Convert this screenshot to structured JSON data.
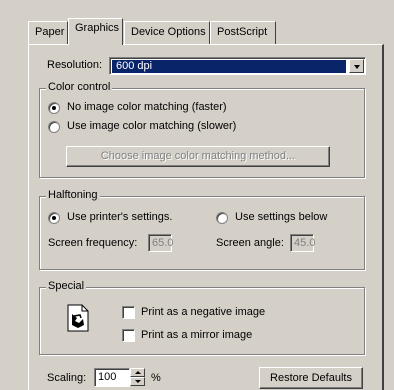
{
  "tabs": [
    "Paper",
    "Graphics",
    "Device Options",
    "PostScript"
  ],
  "active_tab": "Graphics",
  "resolution": {
    "label": "Resolution:",
    "value": "600 dpi"
  },
  "color_control": {
    "title": "Color control",
    "option_none": "No image color matching (faster)",
    "option_use": "Use image color matching (slower)",
    "choose_button": "Choose image color matching method..."
  },
  "halftoning": {
    "title": "Halftoning",
    "option_printer": "Use printer's settings.",
    "option_below": "Use settings below",
    "frequency_label": "Screen frequency:",
    "frequency_value": "65.0",
    "angle_label": "Screen angle:",
    "angle_value": "45.0"
  },
  "special": {
    "title": "Special",
    "negative": "Print as a negative image",
    "mirror": "Print as a mirror image"
  },
  "scaling": {
    "label": "Scaling:",
    "value": "100",
    "unit": "%"
  },
  "restore_button": "Restore Defaults",
  "icons": [
    "dropdown-arrow-icon",
    "document-icon",
    "spin-up-icon",
    "spin-down-icon"
  ]
}
